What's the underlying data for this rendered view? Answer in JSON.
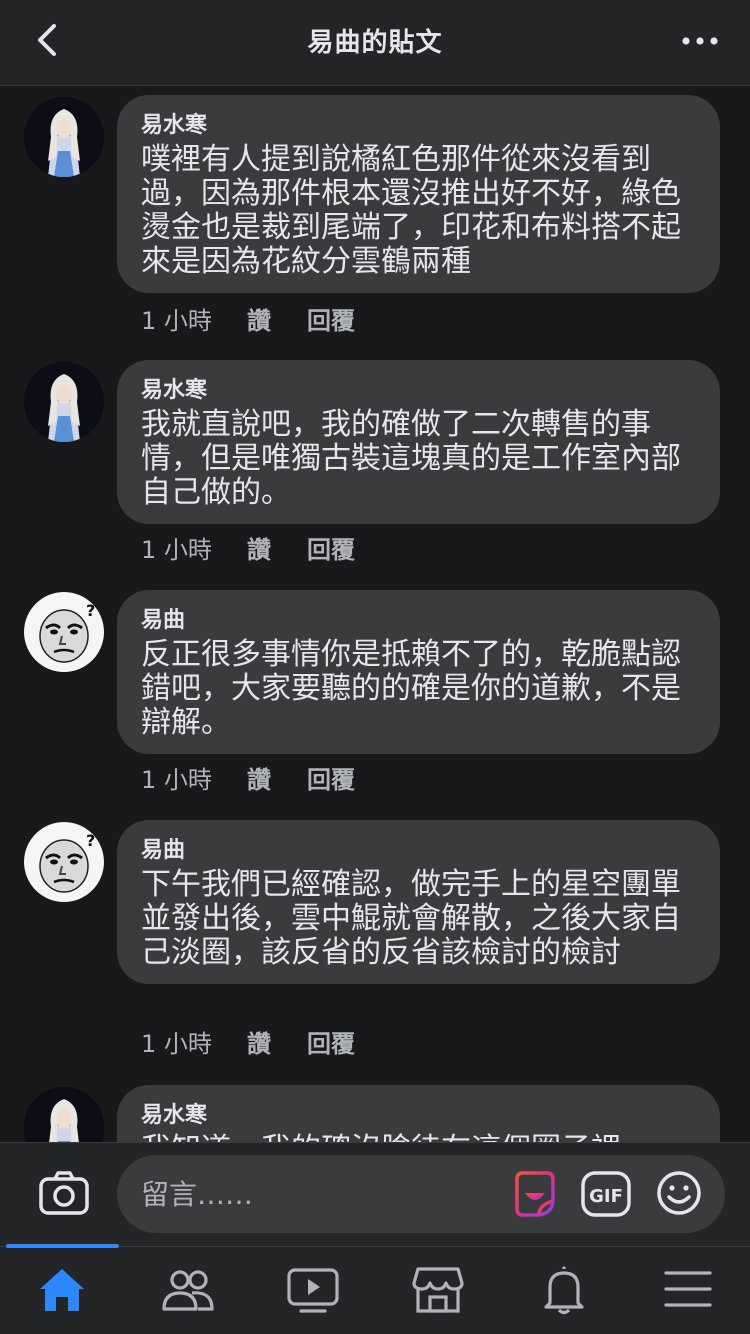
{
  "header": {
    "title": "易曲的貼文"
  },
  "comments": [
    {
      "author": "易水寒",
      "avatar": "woman-portrait",
      "text": "噗裡有人提到說橘紅色那件從來沒看到過，因為那件根本還沒推出好不好，綠色燙金也是裁到尾端了，印花和布料搭不起來是因為花紋分雲鶴兩種",
      "time": "1 小時",
      "like": "讚",
      "reply": "回覆"
    },
    {
      "author": "易水寒",
      "avatar": "woman-portrait",
      "text": "我就直說吧，我的確做了二次轉售的事情，但是唯獨古裝這塊真的是工作室內部自己做的。",
      "time": "1 小時",
      "like": "讚",
      "reply": "回覆"
    },
    {
      "author": "易曲",
      "avatar": "meme-face",
      "text": "反正很多事情你是抵賴不了的，乾脆點認錯吧，大家要聽的的確是你的道歉，不是辯解。",
      "time": "1 小時",
      "like": "讚",
      "reply": "回覆"
    },
    {
      "author": "易曲",
      "avatar": "meme-face",
      "text": "下午我們已經確認，做完手上的星空團單並發出後，雲中鯤就會解散，之後大家自己淡圈，該反省的反省該檢討的檢討",
      "time": "1 小時",
      "like": "讚",
      "reply": "回覆"
    },
    {
      "author": "易水寒",
      "avatar": "woman-portrait",
      "text": "我知道，我的確沒臉待在這個圈子裡",
      "time": "",
      "like": "",
      "reply": ""
    }
  ],
  "composer": {
    "placeholder": "留言……",
    "gif_label": "GIF"
  },
  "icons": {
    "back": "chevron-left-icon",
    "more": "more-dots-icon",
    "camera": "camera-icon",
    "sticker": "sticker-icon",
    "gif": "gif-icon",
    "emoji": "emoji-icon",
    "home": "home-icon",
    "friends": "friends-icon",
    "watch": "watch-icon",
    "marketplace": "marketplace-icon",
    "notifications": "bell-icon",
    "menu": "menu-icon"
  },
  "colors": {
    "accent": "#2d88ff",
    "background": "#18191a",
    "bubble": "#3a3b3c",
    "bar": "#242526"
  }
}
